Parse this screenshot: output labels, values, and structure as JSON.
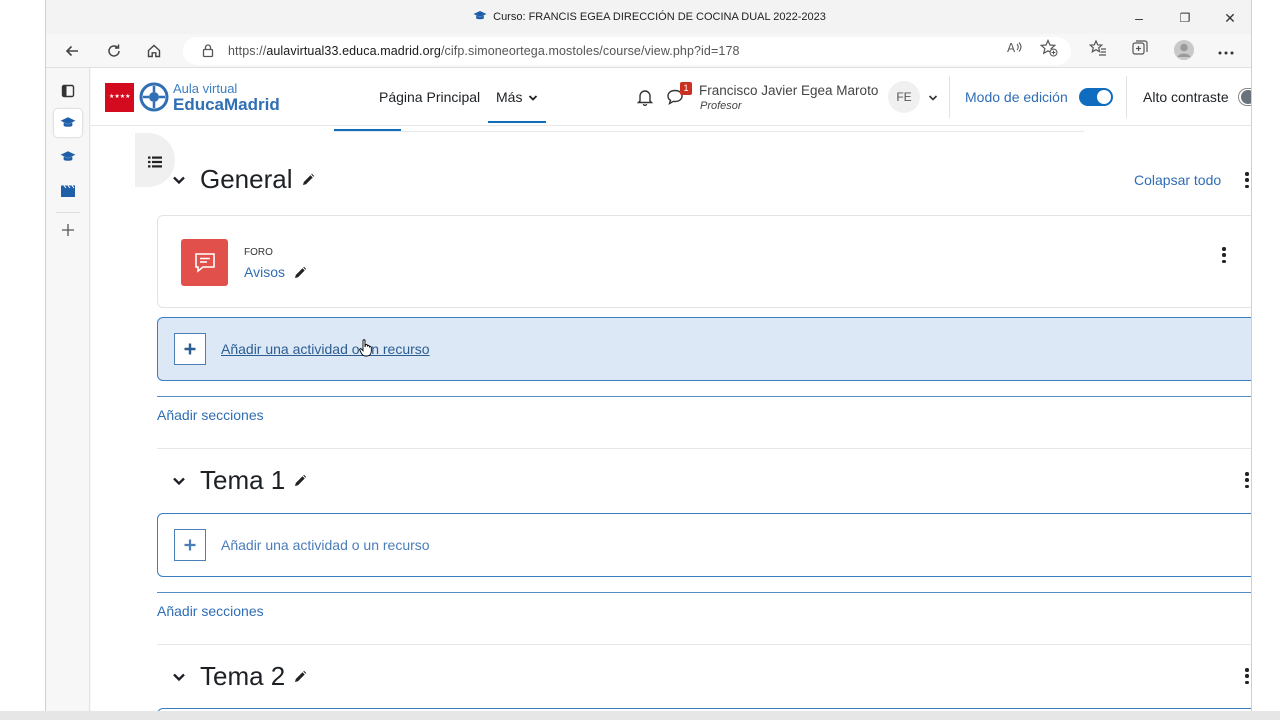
{
  "browser": {
    "window_title": "Curso: FRANCIS EGEA DIRECCIÓN DE COCINA DUAL 2022-2023",
    "url_prefix": "https://",
    "url_host": "aulavirtual33.educa.madrid.org",
    "url_path": "/cifp.simoneortega.mostoles/course/view.php?id=178",
    "controls": {
      "minimize": "–",
      "restore": "❐",
      "close": "✕"
    }
  },
  "brand": {
    "line1": "Aula virtual",
    "line2": "EducaMadrid",
    "flag_text": "★★★★"
  },
  "nav": {
    "home_label": "Página Principal",
    "more_label": "Más"
  },
  "user": {
    "name": "Francisco Javier Egea Maroto",
    "role": "Profesor",
    "initials": "FE",
    "message_count": "1"
  },
  "toggles": {
    "edit_mode_label": "Modo de edición",
    "edit_mode_on": true,
    "high_contrast_label": "Alto contraste",
    "high_contrast_on": false
  },
  "course": {
    "collapse_all": "Colapsar todo",
    "sections": [
      {
        "title": "General",
        "activities": [
          {
            "type": "FORO",
            "name": "Avisos",
            "icon": "forum-icon"
          }
        ],
        "add_activity": "Añadir una actividad o un recurso",
        "add_sections": "Añadir secciones"
      },
      {
        "title": "Tema 1",
        "activities": [],
        "add_activity": "Añadir una actividad o un recurso",
        "add_sections": "Añadir secciones"
      },
      {
        "title": "Tema 2",
        "activities": []
      }
    ]
  },
  "colors": {
    "accent": "#0f6cbf",
    "forum": "#e2504b",
    "madrid_red": "#d40b1e",
    "link": "#2f6db5"
  }
}
